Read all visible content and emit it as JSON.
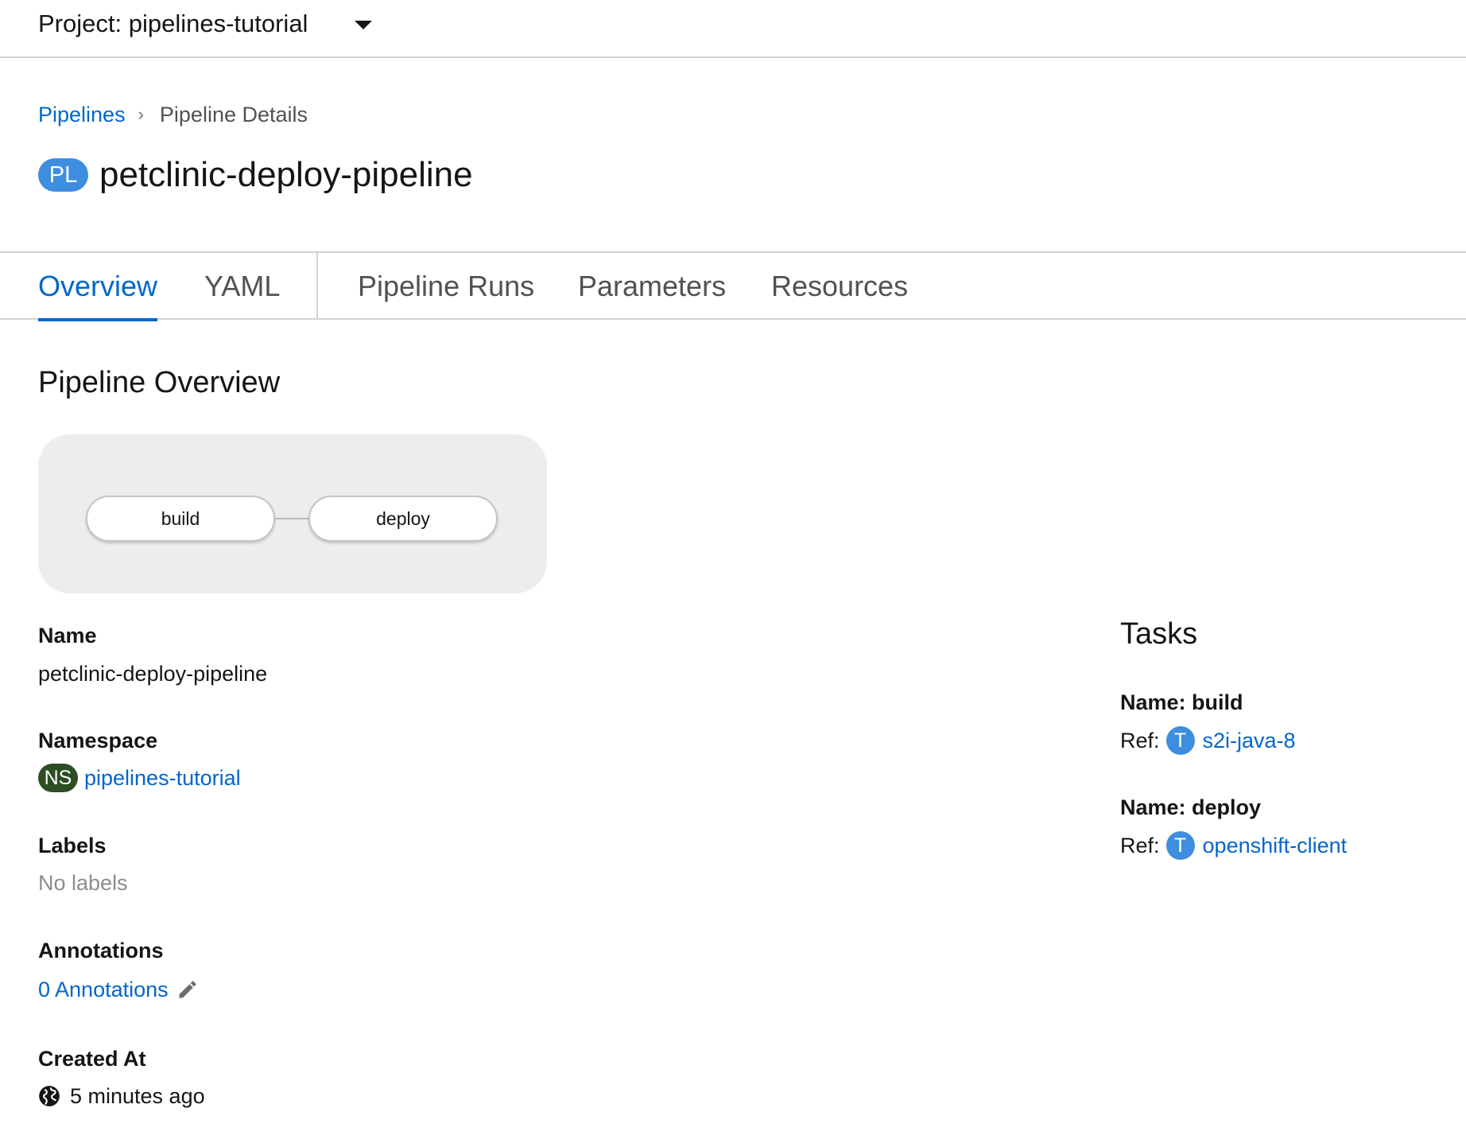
{
  "project": {
    "label": "Project: pipelines-tutorial"
  },
  "breadcrumb": {
    "parent": "Pipelines",
    "current": "Pipeline Details"
  },
  "title": {
    "badge": "PL",
    "name": "petclinic-deploy-pipeline"
  },
  "tabs": [
    {
      "label": "Overview",
      "active": true
    },
    {
      "label": "YAML",
      "active": false
    },
    {
      "label": "Pipeline Runs",
      "active": false
    },
    {
      "label": "Parameters",
      "active": false
    },
    {
      "label": "Resources",
      "active": false
    }
  ],
  "overview": {
    "title": "Pipeline Overview",
    "graph": {
      "nodes": [
        "build",
        "deploy"
      ]
    }
  },
  "details": {
    "name_label": "Name",
    "name_value": "petclinic-deploy-pipeline",
    "namespace_label": "Namespace",
    "namespace_badge": "NS",
    "namespace_value": "pipelines-tutorial",
    "labels_label": "Labels",
    "labels_value": "No labels",
    "annotations_label": "Annotations",
    "annotations_value": "0 Annotations",
    "created_label": "Created At",
    "created_value": "5 minutes ago"
  },
  "tasks": {
    "title": "Tasks",
    "ref_prefix": "Ref:",
    "ref_badge": "T",
    "items": [
      {
        "name": "Name: build",
        "ref": "s2i-java-8"
      },
      {
        "name": "Name: deploy",
        "ref": "openshift-client"
      }
    ]
  },
  "colors": {
    "link": "#0066cc",
    "pl_badge": "#3e8edf",
    "ns_badge": "#2d4d24",
    "task_badge": "#3e8edf"
  },
  "icons": {
    "project_dropdown": "caret-down-icon",
    "breadcrumb_separator": "chevron-right-icon",
    "edit": "pencil-icon",
    "timestamp": "globe-icon"
  }
}
